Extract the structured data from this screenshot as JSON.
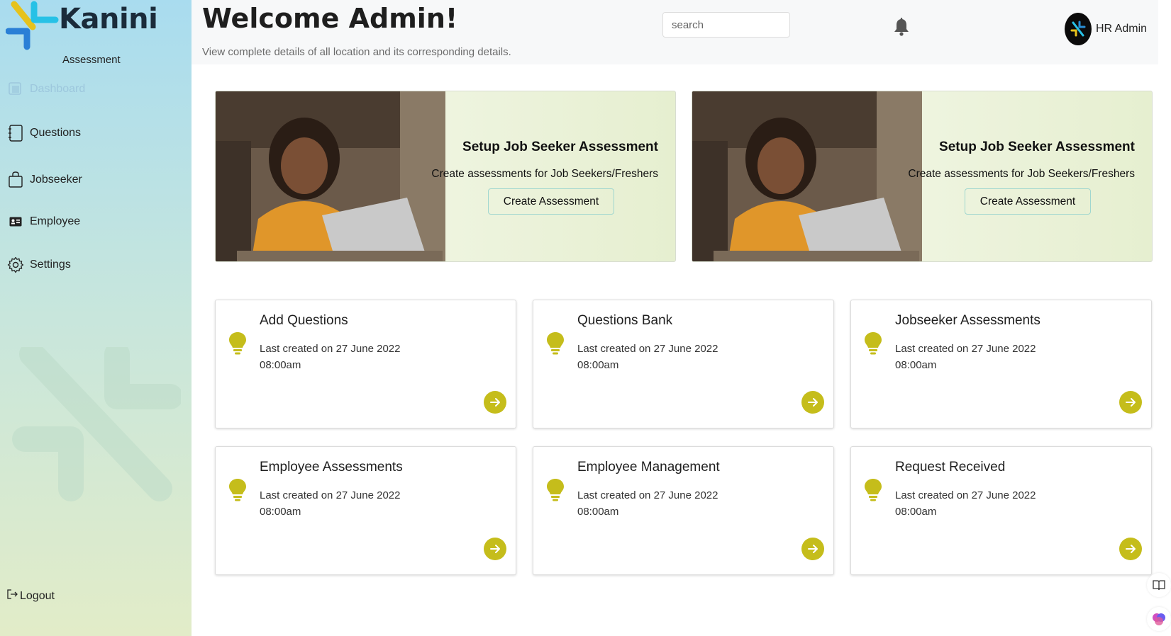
{
  "brand": {
    "name": "Kanini",
    "subtitle": "Assessment"
  },
  "sidebar": {
    "items": [
      {
        "label": "Dashboard",
        "icon": "dashboard-icon",
        "active": true
      },
      {
        "label": "Questions",
        "icon": "questions-icon"
      },
      {
        "label": "Jobseeker",
        "icon": "bag-icon"
      },
      {
        "label": "Employee",
        "icon": "id-card-icon"
      },
      {
        "label": "Settings",
        "icon": "gear-icon"
      }
    ],
    "logout": "Logout"
  },
  "header": {
    "title": "Welcome Admin!",
    "subtitle": "View complete details of all location and its corresponding details.",
    "search_placeholder": "search",
    "user_name": "HR Admin"
  },
  "banners": [
    {
      "title": "Setup Job Seeker Assessment",
      "text": "Create assessments for Job Seekers/Freshers",
      "button": "Create Assessment"
    },
    {
      "title": "Setup Job Seeker Assessment",
      "text": "Create assessments for Job Seekers/Freshers",
      "button": "Create Assessment"
    }
  ],
  "cards": [
    {
      "title": "Add Questions",
      "subtitle": "Last created on 27 June 2022",
      "time": "08:00am"
    },
    {
      "title": "Questions Bank",
      "subtitle": "Last created on 27 June 2022",
      "time": "08:00am"
    },
    {
      "title": "Jobseeker Assessments",
      "subtitle": "Last created on 27 June 2022",
      "time": "08:00am"
    },
    {
      "title": "Employee Assessments",
      "subtitle": "Last created on 27 June 2022",
      "time": "08:00am"
    },
    {
      "title": "Employee Management",
      "subtitle": "Last created on 27 June 2022",
      "time": "08:00am"
    },
    {
      "title": "Request Received",
      "subtitle": "Last created on 27 June 2022",
      "time": "08:00am"
    }
  ],
  "colors": {
    "accent": "#c5bd1b",
    "brand_blue": "#2a8fd6",
    "brand_cyan": "#27c1e6",
    "brand_yellow": "#e6c21c"
  }
}
